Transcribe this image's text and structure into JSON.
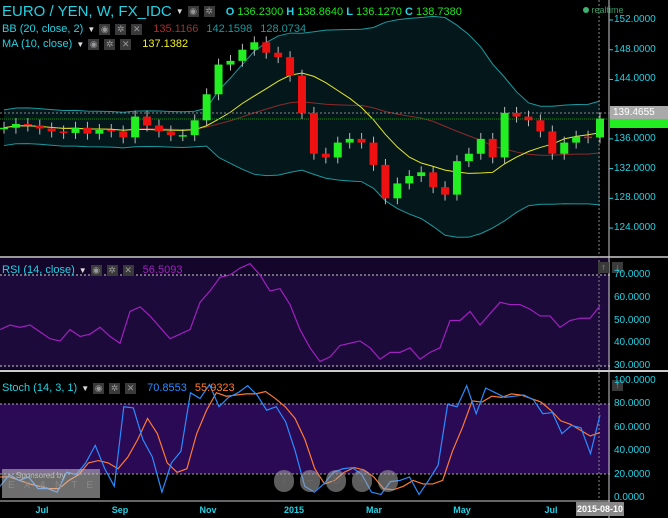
{
  "header": {
    "symbol": "EURO / YEN, W, FX_IDC",
    "o_label": "O",
    "open": "136.2300",
    "h_label": "H",
    "high": "138.8640",
    "l_label": "L",
    "low": "136.1270",
    "c_label": "C",
    "close": "138.7380"
  },
  "bb": {
    "label": "BB (20, close, 2)",
    "mid": "135.1166",
    "upper": "142.1598",
    "lower": "128.0734"
  },
  "ma": {
    "label": "MA (10, close)",
    "value": "137.1382"
  },
  "rsi": {
    "label": "RSI (14, close)",
    "value": "56.5093",
    "axis": [
      "70.0000",
      "60.0000",
      "50.0000",
      "40.0000",
      "30.0000"
    ],
    "values": [
      46,
      48,
      47,
      48,
      45,
      42,
      41,
      46,
      43,
      44,
      47,
      43,
      40,
      54,
      56,
      52,
      47,
      42,
      44,
      46,
      58,
      63,
      69,
      70,
      73,
      75,
      70,
      63,
      64,
      57,
      46,
      38,
      32,
      34,
      39,
      40,
      41,
      38,
      33,
      36,
      36,
      38,
      33,
      36,
      38,
      50,
      50,
      54,
      48,
      53,
      58,
      57,
      57,
      55,
      52,
      52,
      47,
      50,
      51,
      51,
      56.5
    ]
  },
  "stoch": {
    "label": "Stoch (14, 3, 1)",
    "k_value": "70.8553",
    "d_value": "55.9323",
    "axis": [
      "100.0000",
      "80.0000",
      "60.0000",
      "40.0000",
      "20.0000",
      "0.0000"
    ],
    "k": [
      10,
      20,
      15,
      18,
      8,
      8,
      5,
      22,
      20,
      30,
      45,
      25,
      10,
      78,
      77,
      50,
      35,
      5,
      30,
      40,
      90,
      85,
      97,
      78,
      86,
      90,
      96,
      88,
      75,
      78,
      65,
      40,
      10,
      5,
      12,
      22,
      25,
      26,
      20,
      5,
      3,
      14,
      15,
      18,
      3,
      15,
      28,
      80,
      78,
      96,
      72,
      94,
      90,
      86,
      87,
      88,
      84,
      72,
      73,
      55,
      62,
      60,
      38,
      70.9
    ],
    "d": [
      18,
      18,
      15,
      12,
      10,
      8,
      8,
      15,
      20,
      30,
      32,
      30,
      25,
      35,
      50,
      68,
      55,
      30,
      22,
      25,
      55,
      75,
      90,
      87,
      88,
      89,
      89,
      91,
      85,
      78,
      68,
      50,
      25,
      12,
      15,
      22,
      26,
      24,
      18,
      8,
      7,
      10,
      15,
      12,
      12,
      15,
      40,
      60,
      83,
      82,
      87,
      86,
      89,
      88,
      85,
      82,
      75,
      66,
      63,
      58,
      53,
      55.9
    ]
  },
  "price": {
    "axis": [
      "152.0000",
      "148.0000",
      "144.0000",
      "136.0000",
      "132.0000",
      "128.0000",
      "124.0000"
    ],
    "crosshair_label": "139.4655",
    "closes": [
      137.5,
      138,
      137.8,
      137.4,
      137,
      136.8,
      137.5,
      136.7,
      137.2,
      137,
      136.2,
      139,
      137.8,
      137,
      136.5,
      136.5,
      138.5,
      142,
      146,
      146.5,
      148,
      149,
      147.6,
      147,
      144.5,
      139.5,
      134,
      133.5,
      135.5,
      136,
      135.5,
      132.5,
      128,
      130,
      131,
      131.5,
      129.5,
      128.5,
      133,
      134,
      136,
      133.5,
      139.5,
      139,
      138.5,
      137,
      134,
      135.5,
      136.3,
      136.2,
      138.74
    ]
  },
  "status": {
    "realtime": "realtime"
  },
  "xaxis": {
    "labels": [
      "Jul",
      "Sep",
      "Nov",
      "2015",
      "Mar",
      "May",
      "Jul"
    ],
    "current": "2015-08-10"
  },
  "watermark": {
    "line1": "Sponsored by",
    "line2": "EXANTE"
  },
  "colors": {
    "up": "#22ee22",
    "down": "#ee1111",
    "bb": "#1a9aa0",
    "mid": "#8b2a2a",
    "ma": "#e8e820",
    "rsi": "#a020c0",
    "k": "#2a8cff",
    "d": "#ff7a30"
  }
}
